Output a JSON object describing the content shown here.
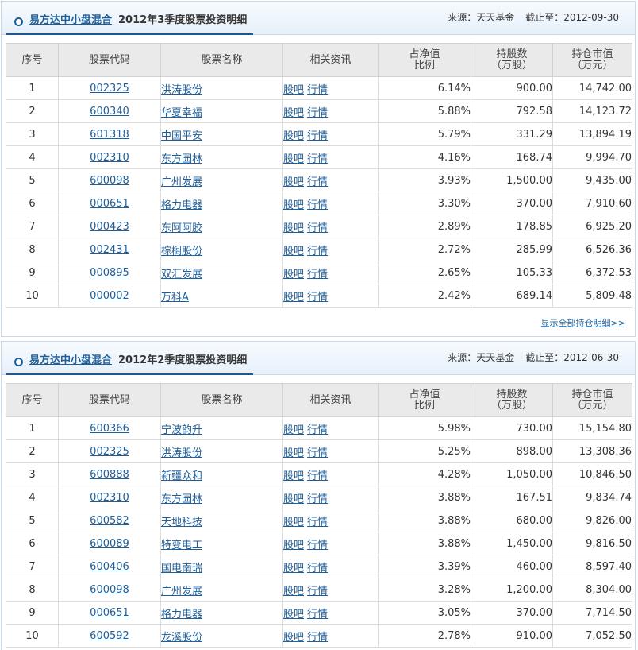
{
  "columns": [
    "序号",
    "股票代码",
    "股票名称",
    "相关资讯",
    "占净值\n比例",
    "持股数\n（万股）",
    "持仓市值\n（万元）"
  ],
  "info_links": [
    "股吧",
    "行情"
  ],
  "panels": [
    {
      "fund_name": "易方达中小盘混合",
      "subtitle": "2012年3季度股票投资明细",
      "source_label": "来源：",
      "source": "天天基金",
      "date_label": "截止至：",
      "date": "2012-09-30",
      "show_all": "显示全部持仓明细>>",
      "rows": [
        {
          "rank": "1",
          "code": "002325",
          "name": "洪涛股份",
          "ratio": "6.14%",
          "shares": "900.00",
          "value": "14,742.00"
        },
        {
          "rank": "2",
          "code": "600340",
          "name": "华夏幸福",
          "ratio": "5.88%",
          "shares": "792.58",
          "value": "14,123.72"
        },
        {
          "rank": "3",
          "code": "601318",
          "name": "中国平安",
          "ratio": "5.79%",
          "shares": "331.29",
          "value": "13,894.19"
        },
        {
          "rank": "4",
          "code": "002310",
          "name": "东方园林",
          "ratio": "4.16%",
          "shares": "168.74",
          "value": "9,994.70"
        },
        {
          "rank": "5",
          "code": "600098",
          "name": "广州发展",
          "ratio": "3.93%",
          "shares": "1,500.00",
          "value": "9,435.00"
        },
        {
          "rank": "6",
          "code": "000651",
          "name": "格力电器",
          "ratio": "3.30%",
          "shares": "370.00",
          "value": "7,910.60"
        },
        {
          "rank": "7",
          "code": "000423",
          "name": "东阿阿胶",
          "ratio": "2.89%",
          "shares": "178.85",
          "value": "6,925.20"
        },
        {
          "rank": "8",
          "code": "002431",
          "name": "棕榈股份",
          "ratio": "2.72%",
          "shares": "285.99",
          "value": "6,526.36"
        },
        {
          "rank": "9",
          "code": "000895",
          "name": "双汇发展",
          "ratio": "2.65%",
          "shares": "105.33",
          "value": "6,372.53"
        },
        {
          "rank": "10",
          "code": "000002",
          "name": "万科A",
          "ratio": "2.42%",
          "shares": "689.14",
          "value": "5,809.48"
        }
      ]
    },
    {
      "fund_name": "易方达中小盘混合",
      "subtitle": "2012年2季度股票投资明细",
      "source_label": "来源：",
      "source": "天天基金",
      "date_label": "截止至：",
      "date": "2012-06-30",
      "rows": [
        {
          "rank": "1",
          "code": "600366",
          "name": "宁波韵升",
          "ratio": "5.98%",
          "shares": "730.00",
          "value": "15,154.80"
        },
        {
          "rank": "2",
          "code": "002325",
          "name": "洪涛股份",
          "ratio": "5.25%",
          "shares": "898.00",
          "value": "13,308.36"
        },
        {
          "rank": "3",
          "code": "600888",
          "name": "新疆众和",
          "ratio": "4.28%",
          "shares": "1,050.00",
          "value": "10,846.50"
        },
        {
          "rank": "4",
          "code": "002310",
          "name": "东方园林",
          "ratio": "3.88%",
          "shares": "167.51",
          "value": "9,834.74"
        },
        {
          "rank": "5",
          "code": "600582",
          "name": "天地科技",
          "ratio": "3.88%",
          "shares": "680.00",
          "value": "9,826.00"
        },
        {
          "rank": "6",
          "code": "600089",
          "name": "特变电工",
          "ratio": "3.88%",
          "shares": "1,450.00",
          "value": "9,816.50"
        },
        {
          "rank": "7",
          "code": "600406",
          "name": "国电南瑞",
          "ratio": "3.39%",
          "shares": "460.00",
          "value": "8,597.40"
        },
        {
          "rank": "8",
          "code": "600098",
          "name": "广州发展",
          "ratio": "3.28%",
          "shares": "1,200.00",
          "value": "8,304.00"
        },
        {
          "rank": "9",
          "code": "000651",
          "name": "格力电器",
          "ratio": "3.05%",
          "shares": "370.00",
          "value": "7,714.50"
        },
        {
          "rank": "10",
          "code": "600592",
          "name": "龙溪股份",
          "ratio": "2.78%",
          "shares": "910.00",
          "value": "7,052.50"
        }
      ]
    }
  ]
}
